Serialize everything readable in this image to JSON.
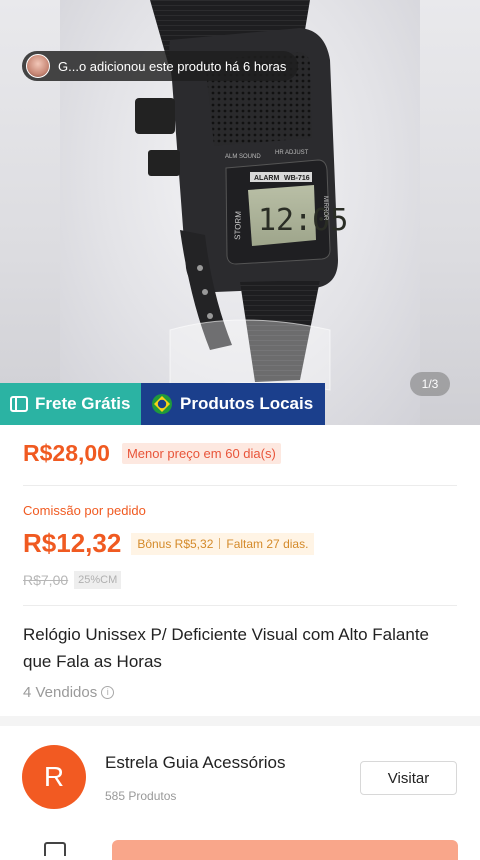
{
  "hero": {
    "notification": "G...o adicionou este produto há 6 horas",
    "image_counter": "1/3"
  },
  "badges": {
    "frete": "Frete Grátis",
    "locais": "Produtos Locais"
  },
  "pricing": {
    "price": "R$28,00",
    "lowest_tag": "Menor preço em 60 dia(s)",
    "commission_label": "Comissão por pedido",
    "commission_value": "R$12,32",
    "bonus": "Bônus R$5,32",
    "remaining": "Faltam 27 dias.",
    "old_commission": "R$7,00",
    "cm_tag": "25%CM"
  },
  "product": {
    "title": "Relógio Unissex P/ Deficiente Visual com Alto Falante que Fala as Horas",
    "sold": "4 Vendidos"
  },
  "store": {
    "initial": "R",
    "name": "Estrela Guia Acessórios",
    "products": "585 Produtos",
    "visit_label": "Visitar"
  },
  "watch": {
    "screen_label": "ALARM",
    "model_label": "WB-716",
    "time_display": "12:05",
    "left_label": "STORM",
    "right_label": "MIRROR",
    "top_left": "ALM SOUND",
    "top_right": "HR ADJUST"
  },
  "colors": {
    "accent": "#f05a21",
    "frete_bg": "#2bb3a3",
    "locais_bg": "#1b3f8c"
  }
}
